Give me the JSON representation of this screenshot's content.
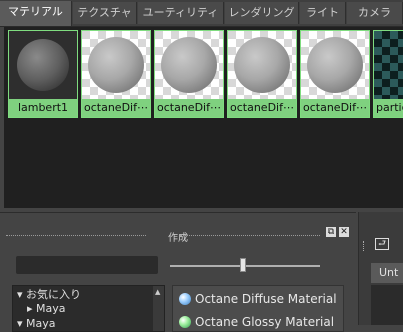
{
  "tabs": [
    {
      "label": "マテリアル",
      "active": true
    },
    {
      "label": "テクスチャ",
      "active": false
    },
    {
      "label": "ユーティリティ",
      "active": false
    },
    {
      "label": "レンダリング",
      "active": false
    },
    {
      "label": "ライト",
      "active": false
    },
    {
      "label": "カメラ",
      "active": false
    }
  ],
  "swatches": [
    {
      "label": "lambert1"
    },
    {
      "label": "octaneDif⋯"
    },
    {
      "label": "octaneDif⋯"
    },
    {
      "label": "octaneDif⋯"
    },
    {
      "label": "octaneDif⋯"
    },
    {
      "label": "partic"
    }
  ],
  "create_panel": {
    "title": "作成",
    "tree_items": [
      {
        "label": "お気に入り",
        "expanded": true
      },
      {
        "label": "Maya",
        "expanded": false
      },
      {
        "label": "Maya",
        "expanded": true
      }
    ],
    "materials": [
      {
        "label": "Octane Diffuse Material",
        "icon": "diffuse-material-icon"
      },
      {
        "label": "Octane Glossy Material",
        "icon": "glossy-material-icon"
      }
    ]
  },
  "right_panel": {
    "tab_label": "Unt"
  },
  "colors": {
    "selection_green": "#7fd17f",
    "swatch_bg": "#202020",
    "panel_bg": "#444444"
  }
}
